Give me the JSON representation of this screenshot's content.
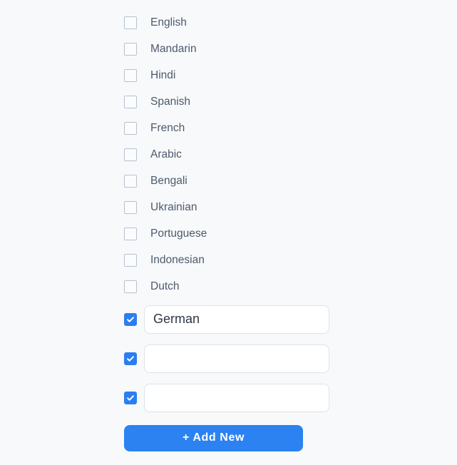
{
  "theme": {
    "background": "#f7f9fb",
    "accent": "#2b7ef0",
    "button_blue": "#2b82f0",
    "label_color": "#4d5a6b",
    "checkbox_border": "#b6c2ce",
    "input_border": "#dde3ea"
  },
  "language_list": {
    "items": [
      {
        "label": "English",
        "checked": false
      },
      {
        "label": "Mandarin",
        "checked": false
      },
      {
        "label": "Hindi",
        "checked": false
      },
      {
        "label": "Spanish",
        "checked": false
      },
      {
        "label": "French",
        "checked": false
      },
      {
        "label": "Arabic",
        "checked": false
      },
      {
        "label": "Bengali",
        "checked": false
      },
      {
        "label": "Ukrainian",
        "checked": false
      },
      {
        "label": "Portuguese",
        "checked": false
      },
      {
        "label": "Indonesian",
        "checked": false
      },
      {
        "label": "Dutch",
        "checked": false
      }
    ]
  },
  "custom_entries": [
    {
      "checked": true,
      "value": "German",
      "placeholder": ""
    },
    {
      "checked": true,
      "value": "",
      "placeholder": ""
    },
    {
      "checked": true,
      "value": "",
      "placeholder": ""
    }
  ],
  "footer": {
    "add_new_label": "+ Add New"
  },
  "icons": {
    "check": "check-icon"
  }
}
